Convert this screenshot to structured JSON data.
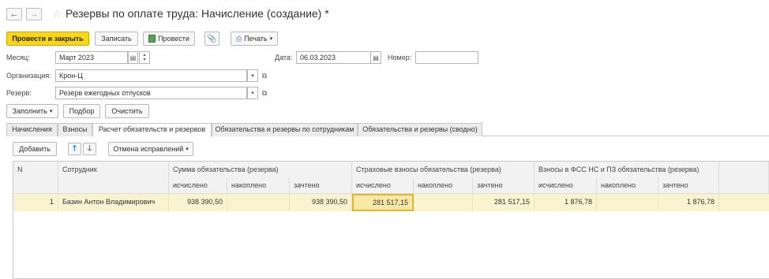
{
  "nav": {
    "back": "←",
    "forward": "→"
  },
  "title": "Резервы по оплате труда: Начисление (создание) *",
  "toolbar": {
    "post_close": "Провести и закрыть",
    "save": "Записать",
    "post": "Провести",
    "print": "Печать"
  },
  "fields": {
    "month_label": "Месяц:",
    "month_value": "Март 2023",
    "date_label": "Дата:",
    "date_value": "06.03.2023",
    "number_label": "Номер:",
    "number_value": "",
    "org_label": "Организация:",
    "org_value": "Крон-Ц",
    "reserve_label": "Резерв:",
    "reserve_value": "Резерв ежегодных отпусков"
  },
  "actions": {
    "fill": "Заполнить",
    "pick": "Подбор",
    "clear": "Очистить"
  },
  "tabs": [
    "Начисления",
    "Взносы",
    "Расчет обязательств и резервов",
    "Обязательства и резервы по сотрудникам",
    "Обязательства и резервы (сводно)"
  ],
  "active_tab": 2,
  "table_toolbar": {
    "add": "Добавить",
    "undo_corrections": "Отмена исправлений"
  },
  "table": {
    "headers": {
      "n": "N",
      "employee": "Сотрудник",
      "group1": "Сумма обязательства (резерва)",
      "group2": "Страховые взносы обязательства (резерва)",
      "group3": "Взносы в ФСС НС и ПЗ обязательства (резерва)",
      "calculated": "исчислено",
      "accrued": "накоплено",
      "credited": "зачтено"
    },
    "rows": [
      {
        "n": "1",
        "employee": "Базин Антон Владимирович",
        "g1_calculated": "938 390,50",
        "g1_accrued": "",
        "g1_credited": "938 390,50",
        "g2_calculated": "281 517,15",
        "g2_accrued": "",
        "g2_credited": "281 517,15",
        "g3_calculated": "1 876,78",
        "g3_accrued": "",
        "g3_credited": "1 876,78"
      }
    ]
  }
}
